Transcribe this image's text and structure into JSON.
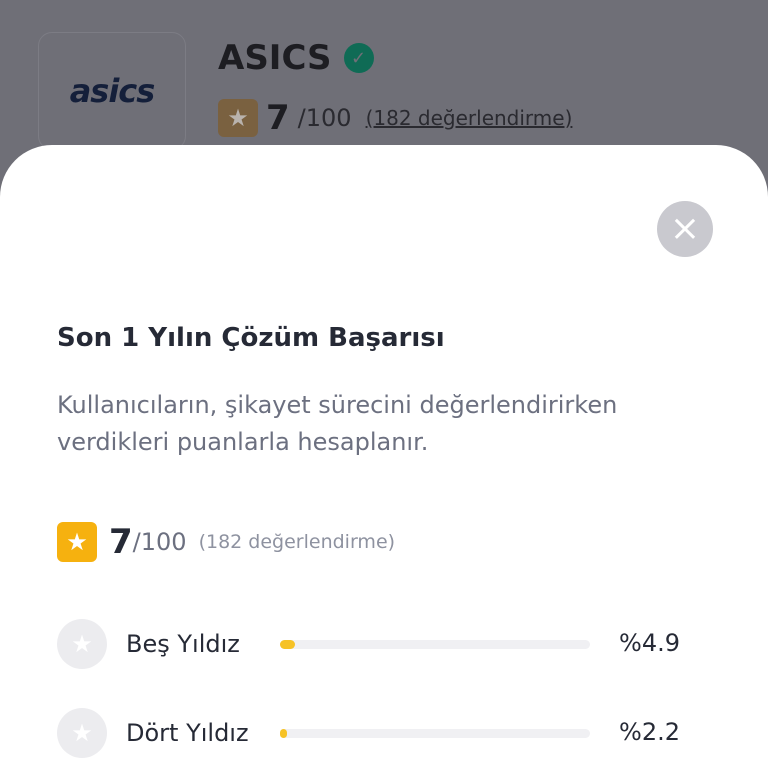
{
  "brand": {
    "logo_text": "asics",
    "name": "ASICS",
    "score": "7",
    "scale": "/100",
    "count": "(182 değerlendirme)"
  },
  "modal": {
    "close_symbol": "×",
    "title": "Son 1 Yılın Çözüm Başarısı",
    "description": "Kullanıcıların, şikayet sürecini değerlendirirken verdikleri puanlarla hesaplanır.",
    "score": "7",
    "scale": "/100",
    "count": "(182 değerlendirme)",
    "distribution": [
      {
        "label": "Beş Yıldız",
        "percent_text": "%4.9",
        "percent": 4.9
      },
      {
        "label": "Dört Yıldız",
        "percent_text": "%2.2",
        "percent": 2.2
      }
    ]
  },
  "icons": {
    "star": "★",
    "verified": "✓"
  },
  "colors": {
    "accent_star": "#f6b10f",
    "bar_fill": "#f6c226",
    "verified_badge": "#0f6b55"
  }
}
